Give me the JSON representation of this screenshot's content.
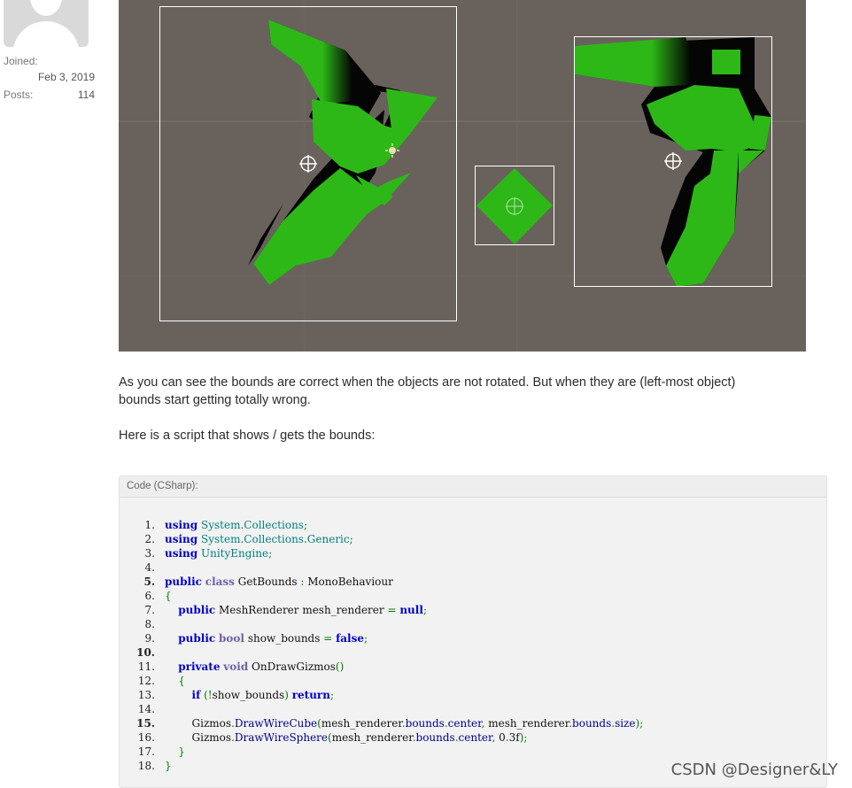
{
  "user": {
    "avatar_icon": "default-avatar-icon",
    "joined_label": "Joined:",
    "joined_value": "Feb 3, 2019",
    "posts_label": "Posts:",
    "posts_value": "114"
  },
  "post": {
    "paragraph1_line1": "As you can see the bounds are correct when the objects are not rotated. But when they are (left-most object)",
    "paragraph1_line2": "bounds start getting totally wrong.",
    "paragraph2": "Here is a script that shows / gets the bounds:"
  },
  "code": {
    "header": "Code (CSharp):",
    "lines": [
      {
        "n": "1.",
        "text": "using System.Collections;"
      },
      {
        "n": "2.",
        "text": "using System.Collections.Generic;"
      },
      {
        "n": "3.",
        "text": "using UnityEngine;"
      },
      {
        "n": "4.",
        "text": ""
      },
      {
        "n": "5.",
        "text": "public class GetBounds : MonoBehaviour"
      },
      {
        "n": "6.",
        "text": "{"
      },
      {
        "n": "7.",
        "text": "    public MeshRenderer mesh_renderer = null;"
      },
      {
        "n": "8.",
        "text": ""
      },
      {
        "n": "9.",
        "text": "    public bool show_bounds = false;"
      },
      {
        "n": "10.",
        "text": ""
      },
      {
        "n": "11.",
        "text": "    private void OnDrawGizmos()"
      },
      {
        "n": "12.",
        "text": "    {"
      },
      {
        "n": "13.",
        "text": "        if (!show_bounds) return;"
      },
      {
        "n": "14.",
        "text": ""
      },
      {
        "n": "15.",
        "text": "        Gizmos.DrawWireCube(mesh_renderer.bounds.center, mesh_renderer.bounds.size);"
      },
      {
        "n": "16.",
        "text": "        Gizmos.DrawWireSphere(mesh_renderer.bounds.center, 0.3f);"
      },
      {
        "n": "17.",
        "text": "    }"
      },
      {
        "n": "18.",
        "text": "}"
      }
    ]
  },
  "watermark": "CSDN @Designer&LY",
  "colors": {
    "scene_bg": "#69625c",
    "mesh_green": "#2db818",
    "mesh_shadow": "#050505",
    "bounds_wire": "#ffffff"
  }
}
